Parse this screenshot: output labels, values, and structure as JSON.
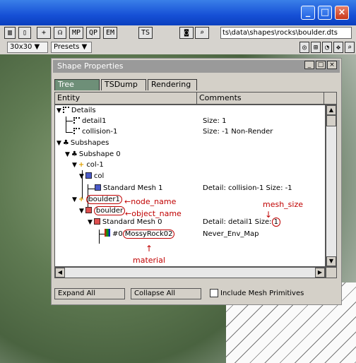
{
  "toolbar": {
    "tool_labels": [
      "MP",
      "QP",
      "EM",
      "TS"
    ],
    "path": "ts\\data\\shapes\\rocks\\boulder.dts",
    "resolution": "30x30",
    "presets": "Presets"
  },
  "dialog": {
    "title": "Shape Properties",
    "tabs": [
      "Tree",
      "TSDump",
      "Rendering"
    ],
    "col_entity": "Entity",
    "col_comments": "Comments",
    "rows": [
      {
        "label": "Details",
        "comment": ""
      },
      {
        "label": "detail1",
        "comment": "Size: 1"
      },
      {
        "label": "collision-1",
        "comment": "Size: -1 Non-Render"
      },
      {
        "label": "Subshapes",
        "comment": ""
      },
      {
        "label": "Subshape 0",
        "comment": ""
      },
      {
        "label": "col-1",
        "comment": ""
      },
      {
        "label": "col",
        "comment": ""
      },
      {
        "label": "Standard Mesh 1",
        "comment": "Detail: collision-1 Size: -1"
      },
      {
        "label": "boulder1",
        "comment": ""
      },
      {
        "label": "boulder",
        "comment": ""
      },
      {
        "label": "Standard Mesh 0",
        "comment": "Detail: detail1 Size:",
        "comment_value": "1"
      },
      {
        "label": "MossyRock02",
        "prefix": "#0",
        "comment": "Never_Env_Map"
      }
    ],
    "expand_all": "Expand All",
    "collapse_all": "Collapse All",
    "include_mesh": "Include Mesh Primitives"
  },
  "annotations": {
    "node_name": "node_name",
    "object_name": "object_name",
    "mesh_size": "mesh_size",
    "material": "material"
  },
  "colors": {
    "annotation": "#c00000",
    "tab_active": "#6e8f78"
  }
}
